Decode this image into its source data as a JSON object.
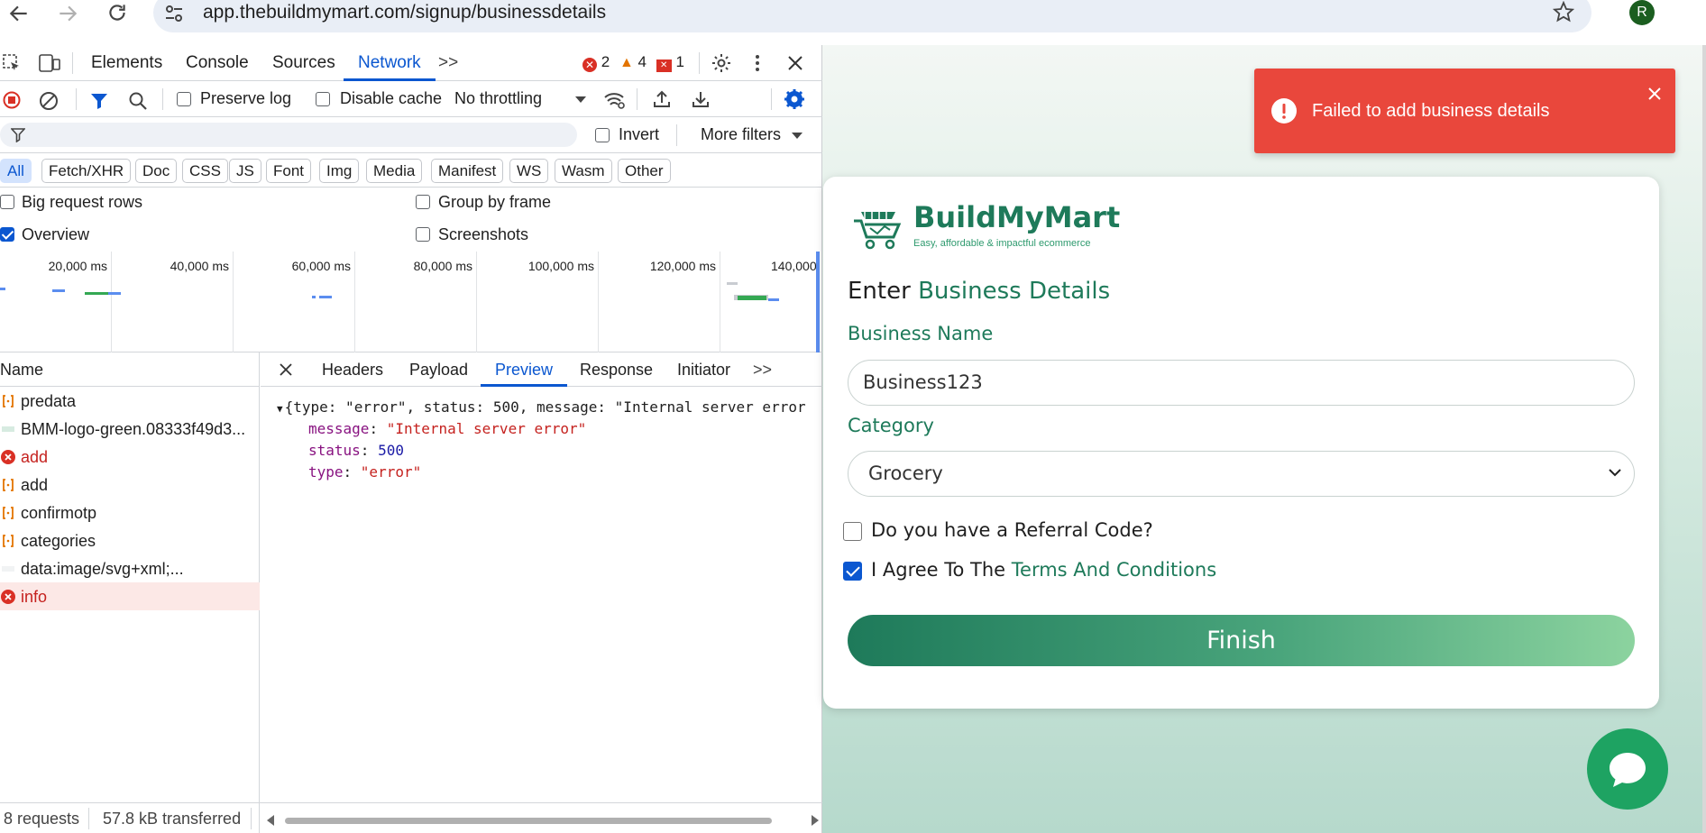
{
  "browser": {
    "url": "app.thebuildmymart.com/signup/businessdetails",
    "avatar_letter": "R"
  },
  "devtools": {
    "tabs": [
      "Elements",
      "Console",
      "Sources",
      "Network"
    ],
    "active_tab": "Network",
    "more_tabs": ">>",
    "issues": {
      "errors": "2",
      "warnings": "4",
      "info": "1"
    },
    "toolbar": {
      "preserve_log": "Preserve log",
      "disable_cache": "Disable cache",
      "throttling": "No throttling"
    },
    "filter": {
      "placeholder": "",
      "invert": "Invert",
      "more_filters": "More filters"
    },
    "type_filters": [
      "All",
      "Fetch/XHR",
      "Doc",
      "CSS",
      "JS",
      "Font",
      "Img",
      "Media",
      "Manifest",
      "WS",
      "Wasm",
      "Other"
    ],
    "options": {
      "big_request_rows": "Big request rows",
      "group_by_frame": "Group by frame",
      "overview": "Overview",
      "screenshots": "Screenshots"
    },
    "timeline_ticks": [
      "20,000 ms",
      "40,000 ms",
      "60,000 ms",
      "80,000 ms",
      "100,000 ms",
      "120,000 ms",
      "140,000"
    ],
    "name_header": "Name",
    "requests": [
      {
        "name": "predata",
        "status": "ok",
        "icon": "fetch-icon"
      },
      {
        "name": "BMM-logo-green.08333f49d3...",
        "status": "ok",
        "icon": "image-icon"
      },
      {
        "name": "add",
        "status": "error",
        "icon": "error-icon"
      },
      {
        "name": "add",
        "status": "ok",
        "icon": "fetch-icon"
      },
      {
        "name": "confirmotp",
        "status": "ok",
        "icon": "fetch-icon"
      },
      {
        "name": "categories",
        "status": "ok",
        "icon": "fetch-icon"
      },
      {
        "name": "data:image/svg+xml;...",
        "status": "ok",
        "icon": "image-icon"
      },
      {
        "name": "info",
        "status": "error",
        "icon": "error-icon",
        "selected": true
      }
    ],
    "detail_tabs": [
      "Headers",
      "Payload",
      "Preview",
      "Response",
      "Initiator"
    ],
    "active_detail_tab": "Preview",
    "preview": {
      "summary": "{type: \"error\", status: 500, message: \"Internal server error",
      "message_key": "message",
      "message_val": "\"Internal server error\"",
      "status_key": "status",
      "status_val": "500",
      "type_key": "type",
      "type_val": "\"error\""
    },
    "status_bar": {
      "requests": "8 requests",
      "transferred": "57.8 kB transferred"
    }
  },
  "app": {
    "toast": "Failed to add business details",
    "brand_name": "BuildMyMart",
    "brand_tagline": "Easy, affordable & impactful ecommerce",
    "heading_prefix": "Enter",
    "heading_highlight": "Business Details",
    "business_name_label": "Business Name",
    "business_name_value": "Business123",
    "category_label": "Category",
    "category_value": "Grocery",
    "referral_label": "Do you have a Referral Code?",
    "agree_prefix": "I Agree To The",
    "agree_link": "Terms And Conditions",
    "finish_label": "Finish"
  },
  "colors": {
    "brand_green": "#1e7a5a",
    "toast_red": "#e9473c",
    "devtools_blue": "#0b57d0"
  }
}
